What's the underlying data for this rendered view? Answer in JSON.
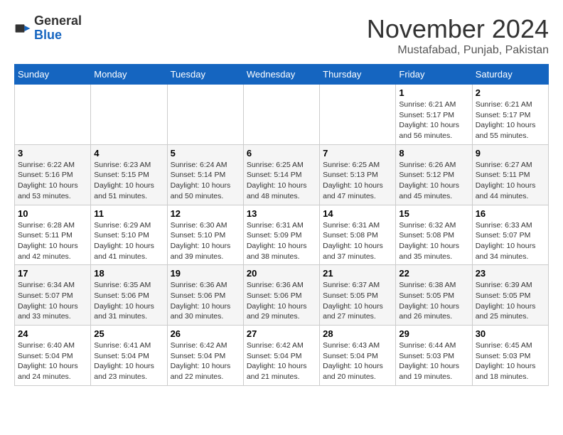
{
  "header": {
    "logo_general": "General",
    "logo_blue": "Blue",
    "month_title": "November 2024",
    "location": "Mustafabad, Punjab, Pakistan"
  },
  "weekdays": [
    "Sunday",
    "Monday",
    "Tuesday",
    "Wednesday",
    "Thursday",
    "Friday",
    "Saturday"
  ],
  "weeks": [
    [
      {
        "day": "",
        "sunrise": "",
        "sunset": "",
        "daylight": ""
      },
      {
        "day": "",
        "sunrise": "",
        "sunset": "",
        "daylight": ""
      },
      {
        "day": "",
        "sunrise": "",
        "sunset": "",
        "daylight": ""
      },
      {
        "day": "",
        "sunrise": "",
        "sunset": "",
        "daylight": ""
      },
      {
        "day": "",
        "sunrise": "",
        "sunset": "",
        "daylight": ""
      },
      {
        "day": "1",
        "sunrise": "Sunrise: 6:21 AM",
        "sunset": "Sunset: 5:17 PM",
        "daylight": "Daylight: 10 hours and 56 minutes."
      },
      {
        "day": "2",
        "sunrise": "Sunrise: 6:21 AM",
        "sunset": "Sunset: 5:17 PM",
        "daylight": "Daylight: 10 hours and 55 minutes."
      }
    ],
    [
      {
        "day": "3",
        "sunrise": "Sunrise: 6:22 AM",
        "sunset": "Sunset: 5:16 PM",
        "daylight": "Daylight: 10 hours and 53 minutes."
      },
      {
        "day": "4",
        "sunrise": "Sunrise: 6:23 AM",
        "sunset": "Sunset: 5:15 PM",
        "daylight": "Daylight: 10 hours and 51 minutes."
      },
      {
        "day": "5",
        "sunrise": "Sunrise: 6:24 AM",
        "sunset": "Sunset: 5:14 PM",
        "daylight": "Daylight: 10 hours and 50 minutes."
      },
      {
        "day": "6",
        "sunrise": "Sunrise: 6:25 AM",
        "sunset": "Sunset: 5:14 PM",
        "daylight": "Daylight: 10 hours and 48 minutes."
      },
      {
        "day": "7",
        "sunrise": "Sunrise: 6:25 AM",
        "sunset": "Sunset: 5:13 PM",
        "daylight": "Daylight: 10 hours and 47 minutes."
      },
      {
        "day": "8",
        "sunrise": "Sunrise: 6:26 AM",
        "sunset": "Sunset: 5:12 PM",
        "daylight": "Daylight: 10 hours and 45 minutes."
      },
      {
        "day": "9",
        "sunrise": "Sunrise: 6:27 AM",
        "sunset": "Sunset: 5:11 PM",
        "daylight": "Daylight: 10 hours and 44 minutes."
      }
    ],
    [
      {
        "day": "10",
        "sunrise": "Sunrise: 6:28 AM",
        "sunset": "Sunset: 5:11 PM",
        "daylight": "Daylight: 10 hours and 42 minutes."
      },
      {
        "day": "11",
        "sunrise": "Sunrise: 6:29 AM",
        "sunset": "Sunset: 5:10 PM",
        "daylight": "Daylight: 10 hours and 41 minutes."
      },
      {
        "day": "12",
        "sunrise": "Sunrise: 6:30 AM",
        "sunset": "Sunset: 5:10 PM",
        "daylight": "Daylight: 10 hours and 39 minutes."
      },
      {
        "day": "13",
        "sunrise": "Sunrise: 6:31 AM",
        "sunset": "Sunset: 5:09 PM",
        "daylight": "Daylight: 10 hours and 38 minutes."
      },
      {
        "day": "14",
        "sunrise": "Sunrise: 6:31 AM",
        "sunset": "Sunset: 5:08 PM",
        "daylight": "Daylight: 10 hours and 37 minutes."
      },
      {
        "day": "15",
        "sunrise": "Sunrise: 6:32 AM",
        "sunset": "Sunset: 5:08 PM",
        "daylight": "Daylight: 10 hours and 35 minutes."
      },
      {
        "day": "16",
        "sunrise": "Sunrise: 6:33 AM",
        "sunset": "Sunset: 5:07 PM",
        "daylight": "Daylight: 10 hours and 34 minutes."
      }
    ],
    [
      {
        "day": "17",
        "sunrise": "Sunrise: 6:34 AM",
        "sunset": "Sunset: 5:07 PM",
        "daylight": "Daylight: 10 hours and 33 minutes."
      },
      {
        "day": "18",
        "sunrise": "Sunrise: 6:35 AM",
        "sunset": "Sunset: 5:06 PM",
        "daylight": "Daylight: 10 hours and 31 minutes."
      },
      {
        "day": "19",
        "sunrise": "Sunrise: 6:36 AM",
        "sunset": "Sunset: 5:06 PM",
        "daylight": "Daylight: 10 hours and 30 minutes."
      },
      {
        "day": "20",
        "sunrise": "Sunrise: 6:36 AM",
        "sunset": "Sunset: 5:06 PM",
        "daylight": "Daylight: 10 hours and 29 minutes."
      },
      {
        "day": "21",
        "sunrise": "Sunrise: 6:37 AM",
        "sunset": "Sunset: 5:05 PM",
        "daylight": "Daylight: 10 hours and 27 minutes."
      },
      {
        "day": "22",
        "sunrise": "Sunrise: 6:38 AM",
        "sunset": "Sunset: 5:05 PM",
        "daylight": "Daylight: 10 hours and 26 minutes."
      },
      {
        "day": "23",
        "sunrise": "Sunrise: 6:39 AM",
        "sunset": "Sunset: 5:05 PM",
        "daylight": "Daylight: 10 hours and 25 minutes."
      }
    ],
    [
      {
        "day": "24",
        "sunrise": "Sunrise: 6:40 AM",
        "sunset": "Sunset: 5:04 PM",
        "daylight": "Daylight: 10 hours and 24 minutes."
      },
      {
        "day": "25",
        "sunrise": "Sunrise: 6:41 AM",
        "sunset": "Sunset: 5:04 PM",
        "daylight": "Daylight: 10 hours and 23 minutes."
      },
      {
        "day": "26",
        "sunrise": "Sunrise: 6:42 AM",
        "sunset": "Sunset: 5:04 PM",
        "daylight": "Daylight: 10 hours and 22 minutes."
      },
      {
        "day": "27",
        "sunrise": "Sunrise: 6:42 AM",
        "sunset": "Sunset: 5:04 PM",
        "daylight": "Daylight: 10 hours and 21 minutes."
      },
      {
        "day": "28",
        "sunrise": "Sunrise: 6:43 AM",
        "sunset": "Sunset: 5:04 PM",
        "daylight": "Daylight: 10 hours and 20 minutes."
      },
      {
        "day": "29",
        "sunrise": "Sunrise: 6:44 AM",
        "sunset": "Sunset: 5:03 PM",
        "daylight": "Daylight: 10 hours and 19 minutes."
      },
      {
        "day": "30",
        "sunrise": "Sunrise: 6:45 AM",
        "sunset": "Sunset: 5:03 PM",
        "daylight": "Daylight: 10 hours and 18 minutes."
      }
    ]
  ]
}
